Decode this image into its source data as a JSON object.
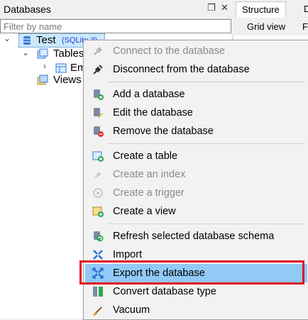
{
  "panel": {
    "title": "Databases",
    "restore_glyph": "❐",
    "close_glyph": "✕",
    "filter_placeholder": "Filter by name"
  },
  "tree": {
    "db_name": "Test",
    "db_type": "(SQLite 3)",
    "tables_label": "Tables",
    "table_item_label": "Em",
    "views_label": "Views"
  },
  "right": {
    "tabs": [
      "Structure",
      "D"
    ],
    "subtabs": [
      "Grid view",
      "F"
    ]
  },
  "menu": {
    "items": [
      {
        "label": "Connect to the database",
        "icon": "plug-icon",
        "disabled": true
      },
      {
        "label": "Disconnect from the database",
        "icon": "unplug-icon",
        "disabled": false
      },
      {
        "label": "Add a database",
        "icon": "database-add-icon",
        "disabled": false
      },
      {
        "label": "Edit the database",
        "icon": "database-edit-icon",
        "disabled": false
      },
      {
        "label": "Remove the database",
        "icon": "database-remove-icon",
        "disabled": false
      },
      {
        "label": "Create a table",
        "icon": "table-add-icon",
        "disabled": false
      },
      {
        "label": "Create an index",
        "icon": "index-add-icon",
        "disabled": true
      },
      {
        "label": "Create a trigger",
        "icon": "trigger-add-icon",
        "disabled": true
      },
      {
        "label": "Create a view",
        "icon": "view-add-icon",
        "disabled": false
      },
      {
        "label": "Refresh selected database schema",
        "icon": "refresh-icon",
        "disabled": false
      },
      {
        "label": "Import",
        "icon": "import-icon",
        "disabled": false
      },
      {
        "label": "Export the database",
        "icon": "export-icon",
        "disabled": false,
        "highlighted": true
      },
      {
        "label": "Convert database type",
        "icon": "convert-icon",
        "disabled": false
      },
      {
        "label": "Vacuum",
        "icon": "vacuum-icon",
        "disabled": false
      }
    ]
  },
  "colors": {
    "highlight": "#91c9f7",
    "callout_border": "#e0101e",
    "db_type": "#1f3fd6"
  }
}
